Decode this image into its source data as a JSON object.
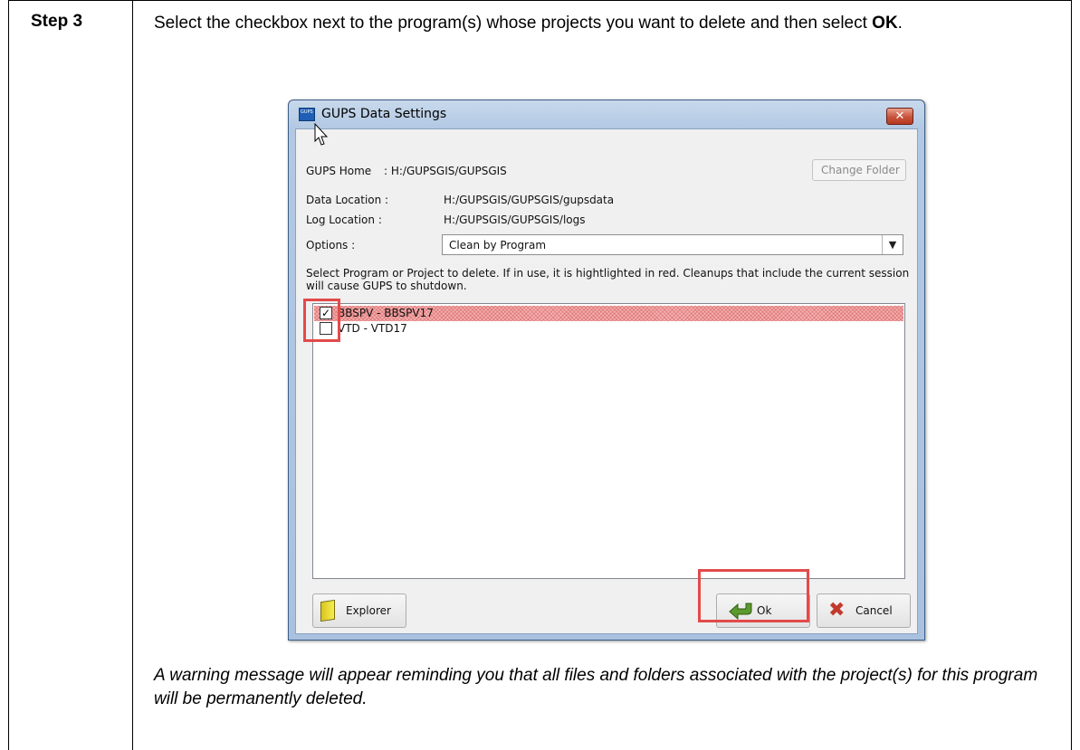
{
  "step": {
    "label": "Step 3",
    "instruction_pre": "Select the checkbox next to the program(s) whose projects you want to delete and then select ",
    "instruction_bold": "OK",
    "instruction_post": ".",
    "note": "A warning message will appear reminding you that all files and folders associated with the project(s) for this program will be permanently deleted."
  },
  "dialog": {
    "app_icon_text": "GUPS",
    "title": "GUPS Data Settings",
    "close_symbol": "✕",
    "gups_home_label": "GUPS Home",
    "gups_home_value": ": H:/GUPSGIS/GUPSGIS",
    "change_folder_label": "Change Folder",
    "data_location_label": "Data Location  :",
    "data_location_value": "H:/GUPSGIS/GUPSGIS/gupsdata",
    "log_location_label": "Log Location   :",
    "log_location_value": "H:/GUPSGIS/GUPSGIS/logs",
    "options_label": "Options :",
    "options_selected": "Clean by Program",
    "description": "Select Program or Project to delete. If in use, it is hightlighted in red. Cleanups that include the current session will cause GUPS to shutdown.",
    "programs": [
      {
        "label": "BBSPV - BBSPV17",
        "checked": true,
        "in_use": true
      },
      {
        "label": "VTD - VTD17",
        "checked": false,
        "in_use": false
      }
    ],
    "explorer_label": "Explorer",
    "ok_label": "Ok",
    "cancel_label": "Cancel",
    "icons": {
      "app": "gups-icon",
      "explorer": "folder-icon",
      "ok": "green-arrow-icon",
      "cancel": "red-x-icon",
      "dropdown": "chevron-down-icon",
      "cursor": "mouse-cursor-icon"
    },
    "colors": {
      "highlight": "#e34a4a",
      "in_use_row": "#f4b0b0",
      "title_bar": "#b3c9e3",
      "close_button": "#c8533a"
    }
  }
}
